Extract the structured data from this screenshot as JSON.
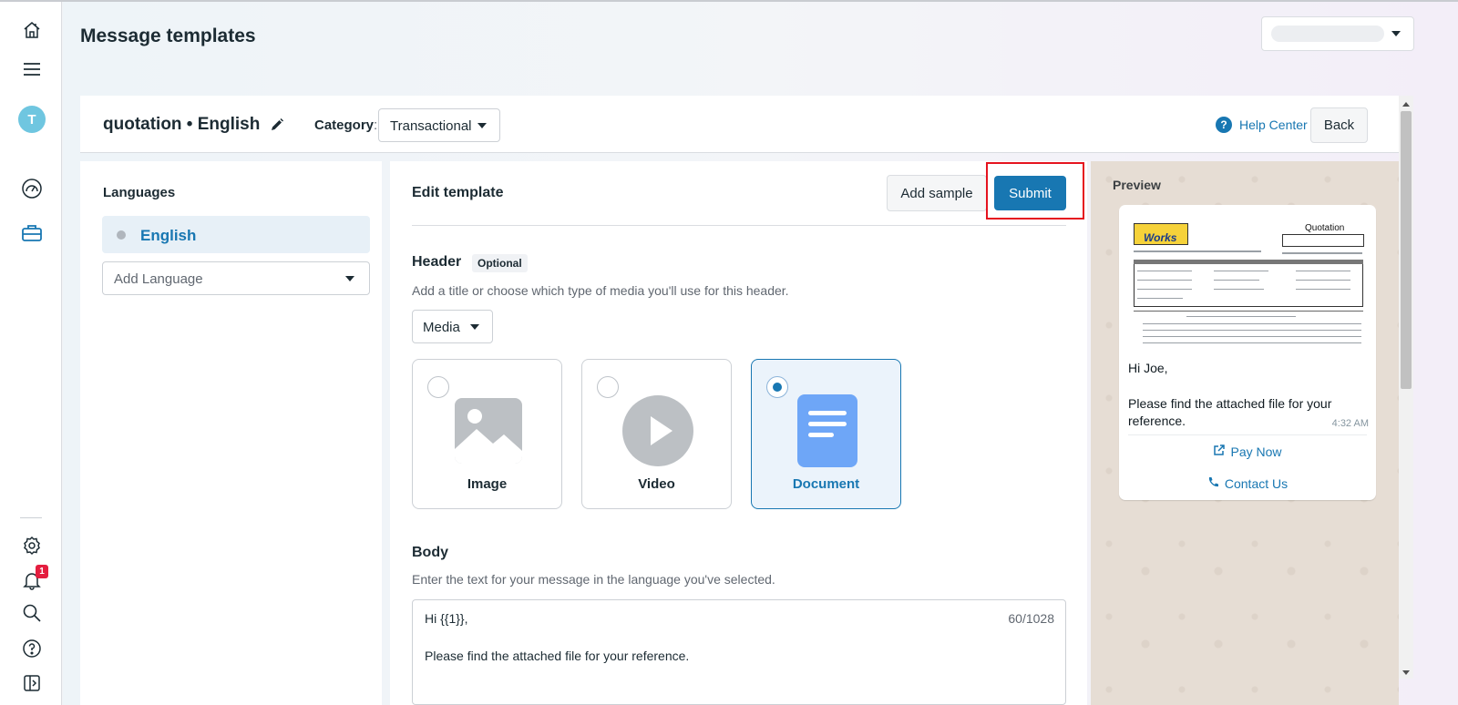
{
  "page": {
    "title": "Message templates"
  },
  "template": {
    "name": "quotation • English",
    "category_label": "Category",
    "category_value": "Transactional",
    "help_center": "Help Center",
    "back_label": "Back"
  },
  "languages": {
    "title": "Languages",
    "items": [
      "English"
    ],
    "add_placeholder": "Add Language"
  },
  "editor": {
    "title": "Edit template",
    "add_sample_label": "Add sample",
    "submit_label": "Submit",
    "header": {
      "title": "Header",
      "badge": "Optional",
      "description": "Add a title or choose which type of media you'll use for this header.",
      "type_value": "Media",
      "media_options": [
        {
          "label": "Image",
          "selected": false
        },
        {
          "label": "Video",
          "selected": false
        },
        {
          "label": "Document",
          "selected": true
        }
      ]
    },
    "body": {
      "title": "Body",
      "description": "Enter the text for your message in the language you've selected.",
      "line1": "Hi {{1}},",
      "line2": "Please find the attached file for your reference.",
      "char_count": "60/1028"
    }
  },
  "preview": {
    "title": "Preview",
    "doc_heading": "Quotation",
    "doc_logo": "Works",
    "greeting": "Hi Joe,",
    "message": "Please find the attached file for your reference.",
    "time": "4:32 AM",
    "cta_pay": "Pay Now",
    "cta_contact": "Contact Us"
  },
  "nav": {
    "avatar_initial": "T",
    "notification_count": "1"
  },
  "colors": {
    "accent": "#1877b2",
    "highlight_border": "#e5131f",
    "preview_bg": "#e6ddd4"
  }
}
